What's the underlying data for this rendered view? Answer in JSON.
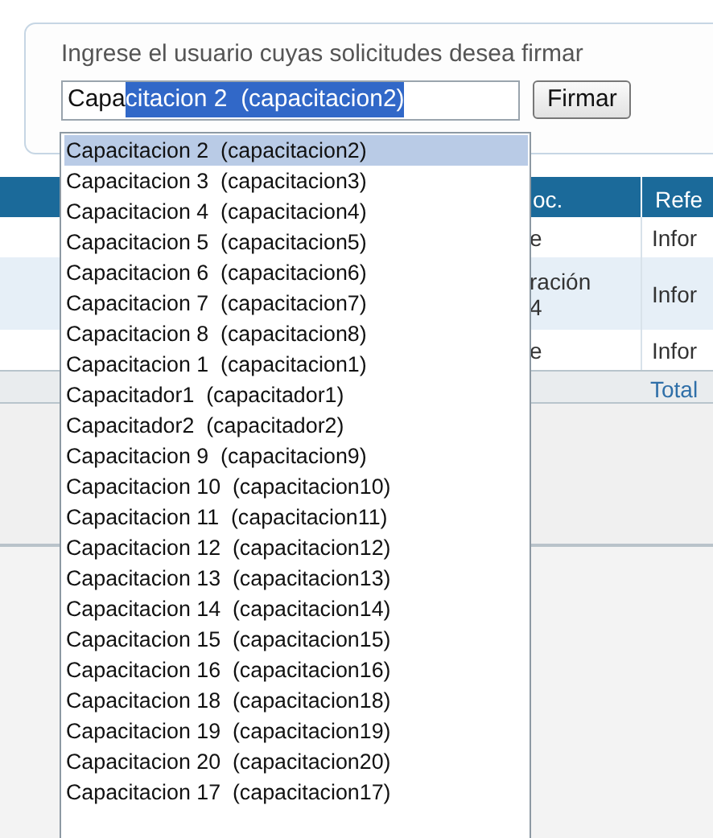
{
  "table": {
    "columns": [
      "oc.",
      "Refe"
    ],
    "rows": [
      {
        "cells": [
          "e",
          "Infor"
        ],
        "shaded": false
      },
      {
        "cells": [
          "ración\n4",
          "Infor"
        ],
        "shaded": true
      },
      {
        "cells": [
          "e",
          "Infor"
        ],
        "shaded": false
      }
    ],
    "total": "Total"
  },
  "sign_panel": {
    "label": "Ingrese el usuario cuyas solicitudes desea firmar",
    "input": {
      "typed": "Capa",
      "selected_text": "citacion 2  (capacitacion2)"
    },
    "button": "Firmar",
    "suggestions": [
      {
        "text": "Capacitacion 2  (capacitacion2)",
        "selected": true
      },
      {
        "text": "Capacitacion 3  (capacitacion3)",
        "selected": false
      },
      {
        "text": "Capacitacion 4  (capacitacion4)",
        "selected": false
      },
      {
        "text": "Capacitacion 5  (capacitacion5)",
        "selected": false
      },
      {
        "text": "Capacitacion 6  (capacitacion6)",
        "selected": false
      },
      {
        "text": "Capacitacion 7  (capacitacion7)",
        "selected": false
      },
      {
        "text": "Capacitacion 8  (capacitacion8)",
        "selected": false
      },
      {
        "text": "Capacitacion 1  (capacitacion1)",
        "selected": false
      },
      {
        "text": "Capacitador1  (capacitador1)",
        "selected": false
      },
      {
        "text": "Capacitador2  (capacitador2)",
        "selected": false
      },
      {
        "text": "Capacitacion 9  (capacitacion9)",
        "selected": false
      },
      {
        "text": "Capacitacion 10  (capacitacion10)",
        "selected": false
      },
      {
        "text": "Capacitacion 11  (capacitacion11)",
        "selected": false
      },
      {
        "text": "Capacitacion 12  (capacitacion12)",
        "selected": false
      },
      {
        "text": "Capacitacion 13  (capacitacion13)",
        "selected": false
      },
      {
        "text": "Capacitacion 14  (capacitacion14)",
        "selected": false
      },
      {
        "text": "Capacitacion 15  (capacitacion15)",
        "selected": false
      },
      {
        "text": "Capacitacion 16  (capacitacion16)",
        "selected": false
      },
      {
        "text": "Capacitacion 18  (capacitacion18)",
        "selected": false
      },
      {
        "text": "Capacitacion 19  (capacitacion19)",
        "selected": false
      },
      {
        "text": "Capacitacion 20  (capacitacion20)",
        "selected": false
      },
      {
        "text": "Capacitacion 17  (capacitacion17)",
        "selected": false
      }
    ]
  }
}
